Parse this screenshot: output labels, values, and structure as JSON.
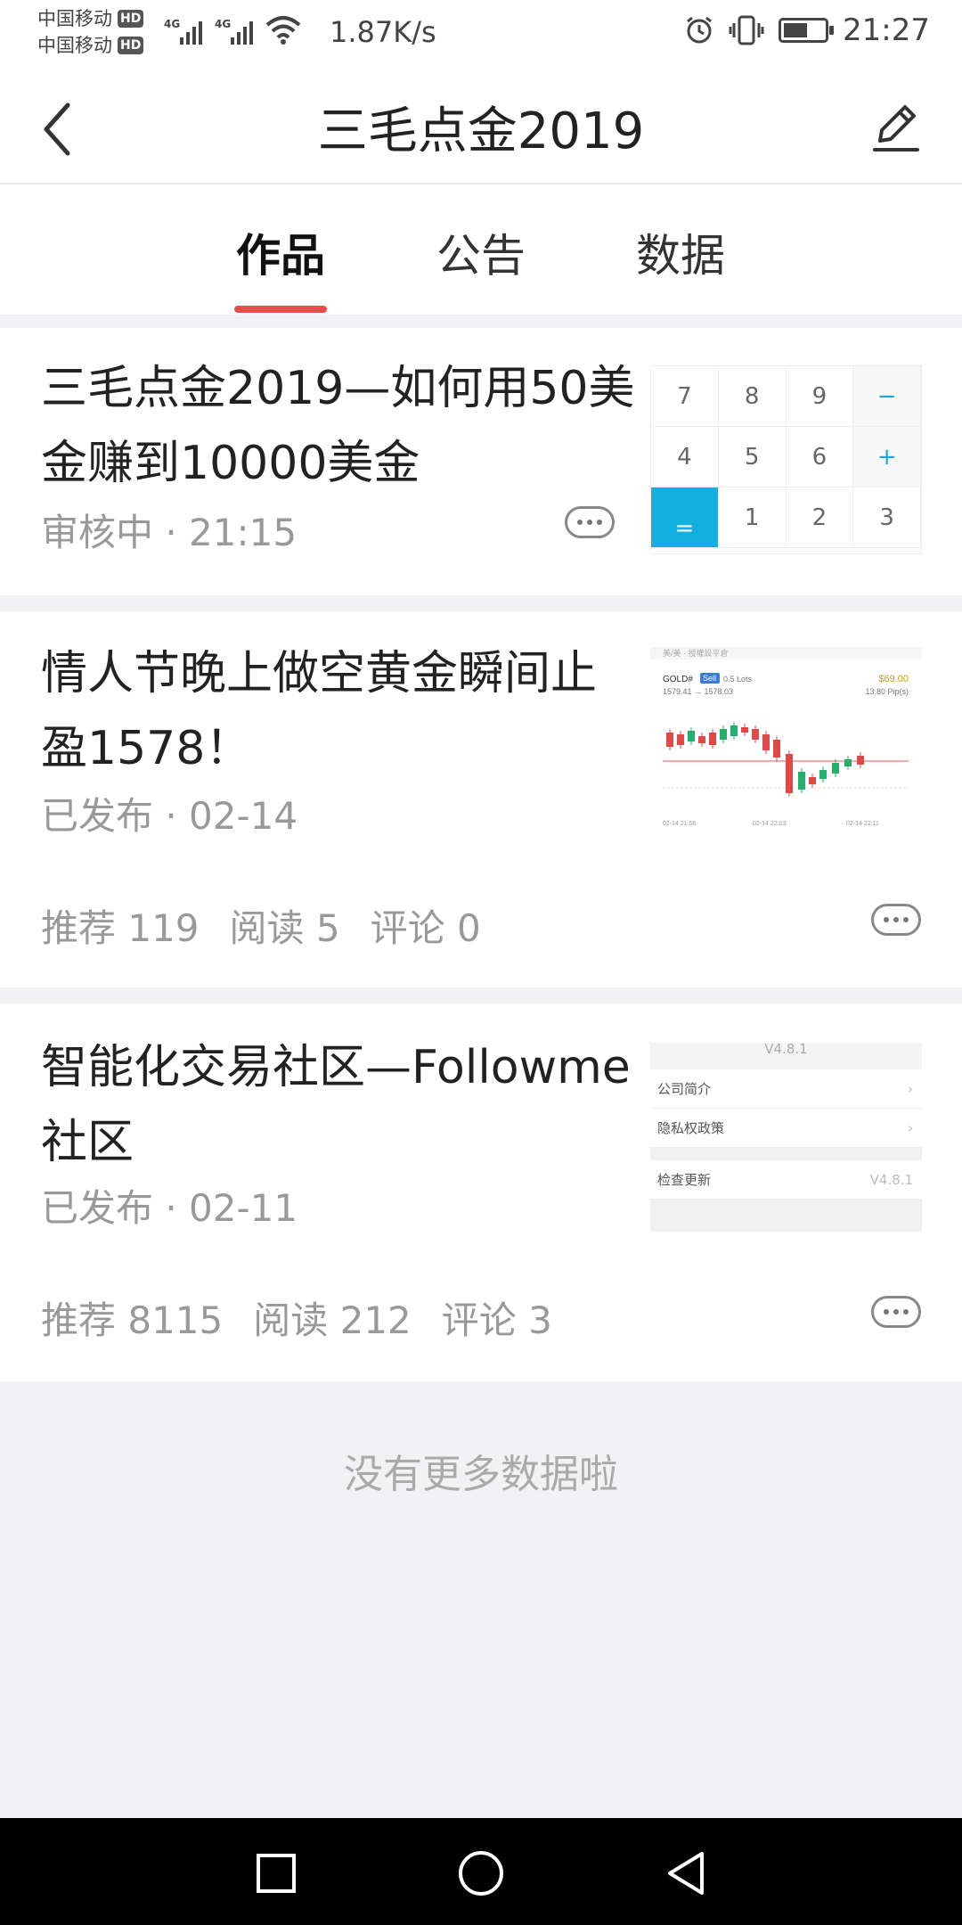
{
  "status_bar": {
    "carrier1": "中国移动",
    "carrier2": "中国移动",
    "hd": "HD",
    "network_tag": "4G",
    "net_speed": "1.87K/s",
    "time": "21:27",
    "battery_level": 0.6
  },
  "navbar": {
    "title": "三毛点金2019"
  },
  "tabs": [
    {
      "label": "作品",
      "active": true
    },
    {
      "label": "公告",
      "active": false
    },
    {
      "label": "数据",
      "active": false
    }
  ],
  "articles": [
    {
      "title": "三毛点金2019—如何用50美金赚到10000美金",
      "meta": "审核中 · 21:15",
      "thumb": "calculator",
      "calc_keys": [
        "7",
        "8",
        "9",
        "−",
        "4",
        "5",
        "6",
        "+",
        "1",
        "2",
        "3",
        "="
      ]
    },
    {
      "title": "情人节晚上做空黄金瞬间止盈1578！",
      "meta": "已发布 · 02-14",
      "stats": {
        "recommend": "推荐 119",
        "read": "阅读 5",
        "comment": "评论 0"
      },
      "thumb": "chart",
      "chart_text": {
        "top_left": "美/美 · 授權設平倉",
        "symbol": "GOLD#",
        "side": "Sell",
        "lots": "0.5 Lots",
        "prices": "1579.41 → 1578.03",
        "pnl": "$69.00",
        "pips": "13.80 Pip(s)",
        "xlabels": [
          "02-14 21:56",
          "02-14 22:03",
          "02-14 22:11"
        ]
      }
    },
    {
      "title": "智能化交易社区—Followme社区",
      "meta": "已发布 · 02-11",
      "stats": {
        "recommend": "推荐 8115",
        "read": "阅读 212",
        "comment": "评论 3"
      },
      "thumb": "settings",
      "settings_text": {
        "version": "V4.8.1",
        "row1": "公司简介",
        "row2": "隐私权政策",
        "row3": "检查更新",
        "row3_value": "V4.8.1"
      }
    }
  ],
  "footer": "没有更多数据啦"
}
